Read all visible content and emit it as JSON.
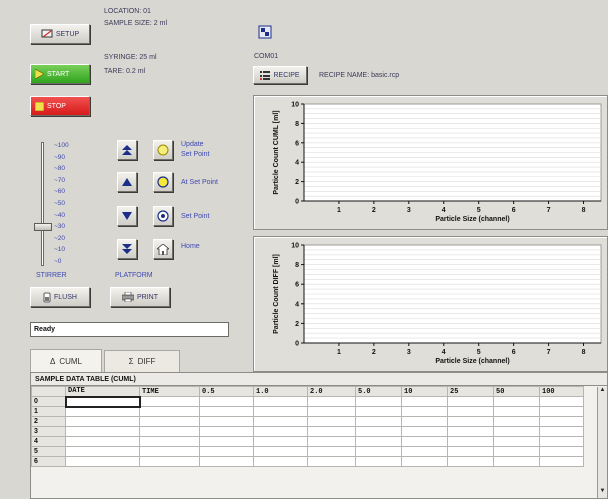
{
  "header": {
    "location": "LOCATION: 01",
    "sample_size": "SAMPLE SIZE: 2 ml",
    "syringe": "SYRINGE: 25 ml",
    "tare": "TARE: 0.2 ml",
    "com_port": "COM01",
    "recipe_name": "RECIPE NAME: basic.rcp"
  },
  "buttons": {
    "setup": "SETUP",
    "start": "START",
    "stop": "STOP",
    "flush": "FLUSH",
    "print": "PRINT",
    "recipe": "RECIPE"
  },
  "stirrer": {
    "label": "STIRRER",
    "ticks": [
      "~100",
      "~90",
      "~80",
      "~70",
      "~60",
      "~50",
      "~40",
      "~30",
      "~20",
      "~10",
      "~0"
    ],
    "level": 30
  },
  "platform": {
    "label": "PLATFORM",
    "update_set_point": [
      "Update",
      "Set Point"
    ],
    "at_set_point": "At Set Point",
    "set_point": "Set Point",
    "home": "Home"
  },
  "status": {
    "text": "Ready"
  },
  "tabs": [
    {
      "symbol": "Δ",
      "label": "CUML"
    },
    {
      "symbol": "Σ",
      "label": "DIFF"
    }
  ],
  "charts": {
    "xlabel": "Particle Size (channel)",
    "top_ylabel": "Particle Count CUML [ml]",
    "bottom_ylabel": "Particle Count DIFF [ml]"
  },
  "chart_data": [
    {
      "type": "line",
      "title": "",
      "xlabel": "Particle Size (channel)",
      "ylabel": "Particle Count CUML [ml]",
      "x_ticks": [
        1,
        2,
        3,
        4,
        5,
        6,
        7,
        8
      ],
      "y_ticks": [
        0,
        2,
        4,
        6,
        8,
        10
      ],
      "xlim": [
        0,
        8.5
      ],
      "ylim": [
        0,
        10
      ],
      "grid": true,
      "series": []
    },
    {
      "type": "line",
      "title": "",
      "xlabel": "Particle Size (channel)",
      "ylabel": "Particle Count DIFF [ml]",
      "x_ticks": [
        1,
        2,
        3,
        4,
        5,
        6,
        7,
        8
      ],
      "y_ticks": [
        0,
        2,
        4,
        6,
        8,
        10
      ],
      "xlim": [
        0,
        8.5
      ],
      "ylim": [
        0,
        10
      ],
      "grid": true,
      "series": []
    }
  ],
  "table": {
    "title": "SAMPLE DATA TABLE (CUML)",
    "columns": [
      "DATE",
      "TIME",
      "0.5",
      "1.0",
      "2.0",
      "5.0",
      "10",
      "25",
      "50",
      "100"
    ],
    "row_headers": [
      "0",
      "1",
      "2",
      "3",
      "4",
      "5",
      "6"
    ]
  }
}
